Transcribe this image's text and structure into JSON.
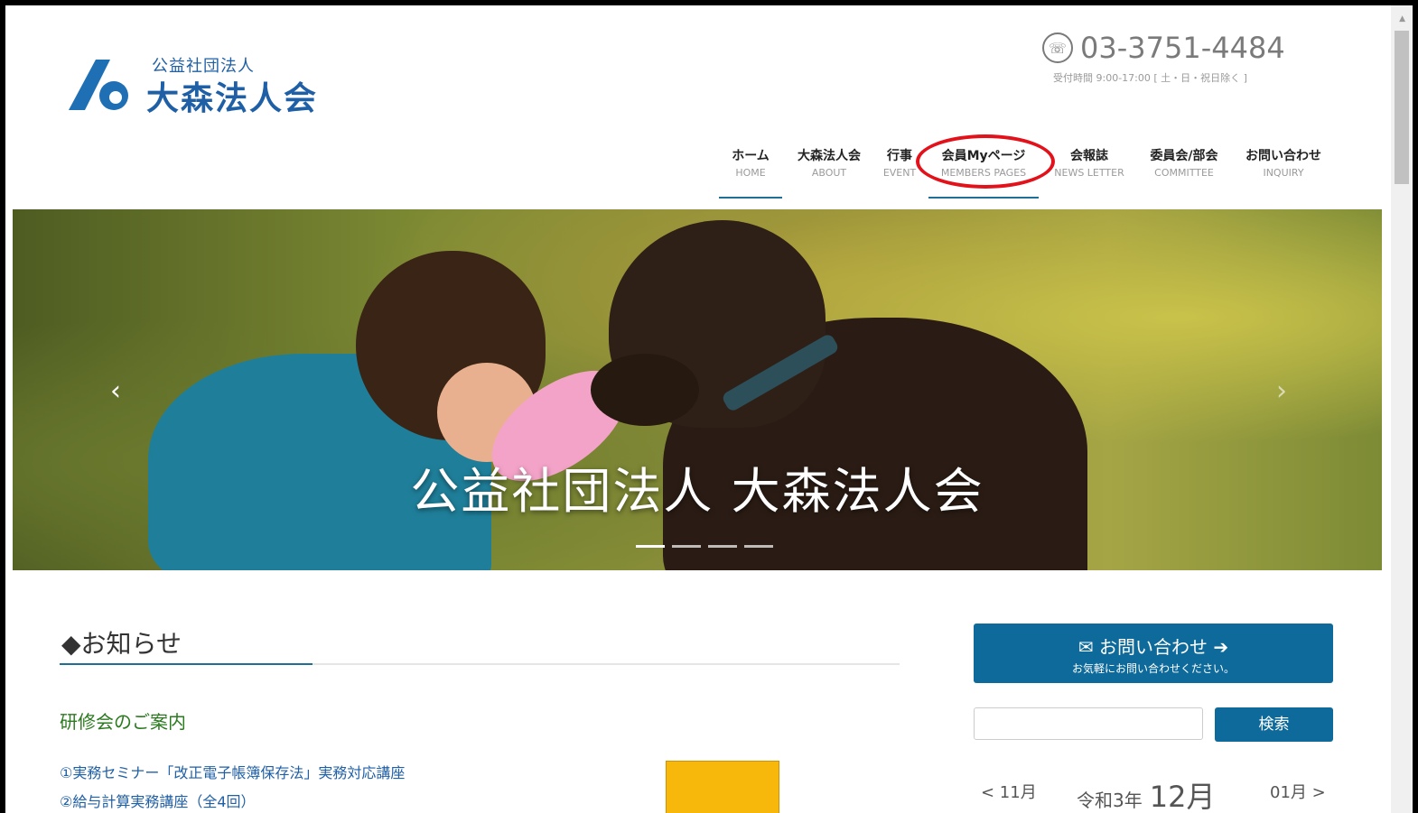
{
  "logo": {
    "sub": "公益社団法人",
    "main": "大森法人会"
  },
  "contact_header": {
    "phone": "03-3751-4484",
    "hours": "受付時間 9:00-17:00 [ 土・日・祝日除く ]"
  },
  "nav": [
    {
      "jp": "ホーム",
      "en": "HOME"
    },
    {
      "jp": "大森法人会",
      "en": "ABOUT"
    },
    {
      "jp": "行事",
      "en": "EVENT"
    },
    {
      "jp": "会員Myページ",
      "en": "MEMBERS PAGES"
    },
    {
      "jp": "会報誌",
      "en": "NEWS LETTER"
    },
    {
      "jp": "委員会/部会",
      "en": "COMMITTEE"
    },
    {
      "jp": "お問い合わせ",
      "en": "INQUIRY"
    }
  ],
  "hero": {
    "title": "公益社団法人 大森法人会",
    "prev": "‹",
    "next": "›"
  },
  "news": {
    "title": "◆お知らせ",
    "subtitle": "研修会のご案内",
    "items": [
      "①実務セミナー「改正電子帳簿保存法」実務対応講座",
      "②給与計算実務講座（全4回）"
    ]
  },
  "sidebar": {
    "contact_title": "お問い合わせ",
    "contact_sub": "お気軽にお問い合わせください。",
    "search_button": "検索",
    "cal_prev": "< 11月",
    "cal_year": "令和3年",
    "cal_month": "12月",
    "cal_next": "01月 >"
  },
  "colors": {
    "brand_blue": "#0e6a9a",
    "highlight_red": "#e3111a",
    "news_green": "#2b7a1f"
  }
}
